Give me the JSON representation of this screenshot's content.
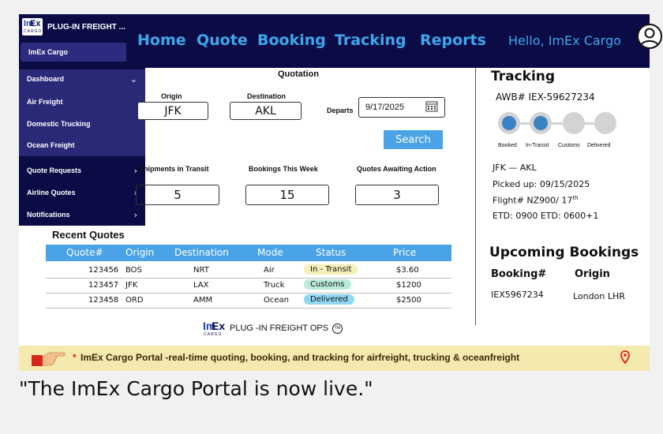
{
  "sidebar": {
    "brand": "PLUG-IN FREIGHT ...",
    "account": "ImEx Cargo",
    "items": [
      {
        "label": "Dashboard"
      },
      {
        "label": "Air Freight"
      },
      {
        "label": "Domestic Trucking"
      },
      {
        "label": "Ocean Freight"
      },
      {
        "label": "Quote Requests"
      },
      {
        "label": "Airline Quotes"
      },
      {
        "label": "Notifications"
      }
    ]
  },
  "nav": {
    "items": [
      "Home",
      "Quote",
      "Booking",
      "Tracking",
      "Reports"
    ],
    "greeting": "Hello, ImEx Cargo"
  },
  "quotation": {
    "title": "Quotation",
    "origin_label": "Origin",
    "origin": "JFK",
    "destination_label": "Destination",
    "destination": "AKL",
    "departs_label": "Departs",
    "departs": "9/17/2025",
    "search_label": "Search"
  },
  "stats": [
    {
      "label": "Shipments in Transit",
      "value": "5"
    },
    {
      "label": "Bookings This Week",
      "value": "15"
    },
    {
      "label": "Quotes Awaiting Action",
      "value": "3"
    }
  ],
  "recent_quotes": {
    "title": "Recent Quotes",
    "columns": [
      "Quote#",
      "Origin",
      "Destination",
      "Mode",
      "Status",
      "Price"
    ],
    "rows": [
      {
        "quote": "123456",
        "origin": "BOS",
        "destination": "NRT",
        "mode": "Air",
        "status": "In - Transit",
        "price": "$3.60"
      },
      {
        "quote": "123457",
        "origin": "JFK",
        "destination": "LAX",
        "mode": "Truck",
        "status": "Customs",
        "price": "$1200"
      },
      {
        "quote": "123458",
        "origin": "ORD",
        "destination": "AMM",
        "mode": "Ocean",
        "status": "Delivered",
        "price": "$2500"
      }
    ],
    "status_colors": {
      "In - Transit": "#f6efb8",
      "Customs": "#b9eadb",
      "Delivered": "#8fd8f4"
    }
  },
  "footer": {
    "brand": "PLUG -IN FREIGHT OPS",
    "tm": "TM"
  },
  "tracking": {
    "title": "Tracking",
    "awb": "AWB# IEX-59627234",
    "steps": [
      "Booked",
      "In-Transit",
      "Customs",
      "Delivered"
    ],
    "completed_steps": 2,
    "route": "JFK — AKL",
    "picked_up": "Picked up: 09/15/2025",
    "flight": "Flight# NZ900/ 17",
    "flight_sup": "th",
    "etd": "ETD: 0900  ETD: 0600+1"
  },
  "upcoming": {
    "title": "Upcoming Bookings",
    "col1": "Booking#",
    "col2": "Origin",
    "booking": "IEX5967234",
    "origin": "London LHR"
  },
  "banner": {
    "star": "*",
    "text": "ImEx Cargo Portal -real-time quoting, booking, and tracking for airfreight, trucking & oceanfreight"
  },
  "caption": "\"The ImEx Cargo Portal is now live.\"",
  "colors": {
    "navy": "#0b0b45",
    "accent": "#3ba9ee",
    "button": "#4aa3e6",
    "banner": "#f4eab0"
  }
}
